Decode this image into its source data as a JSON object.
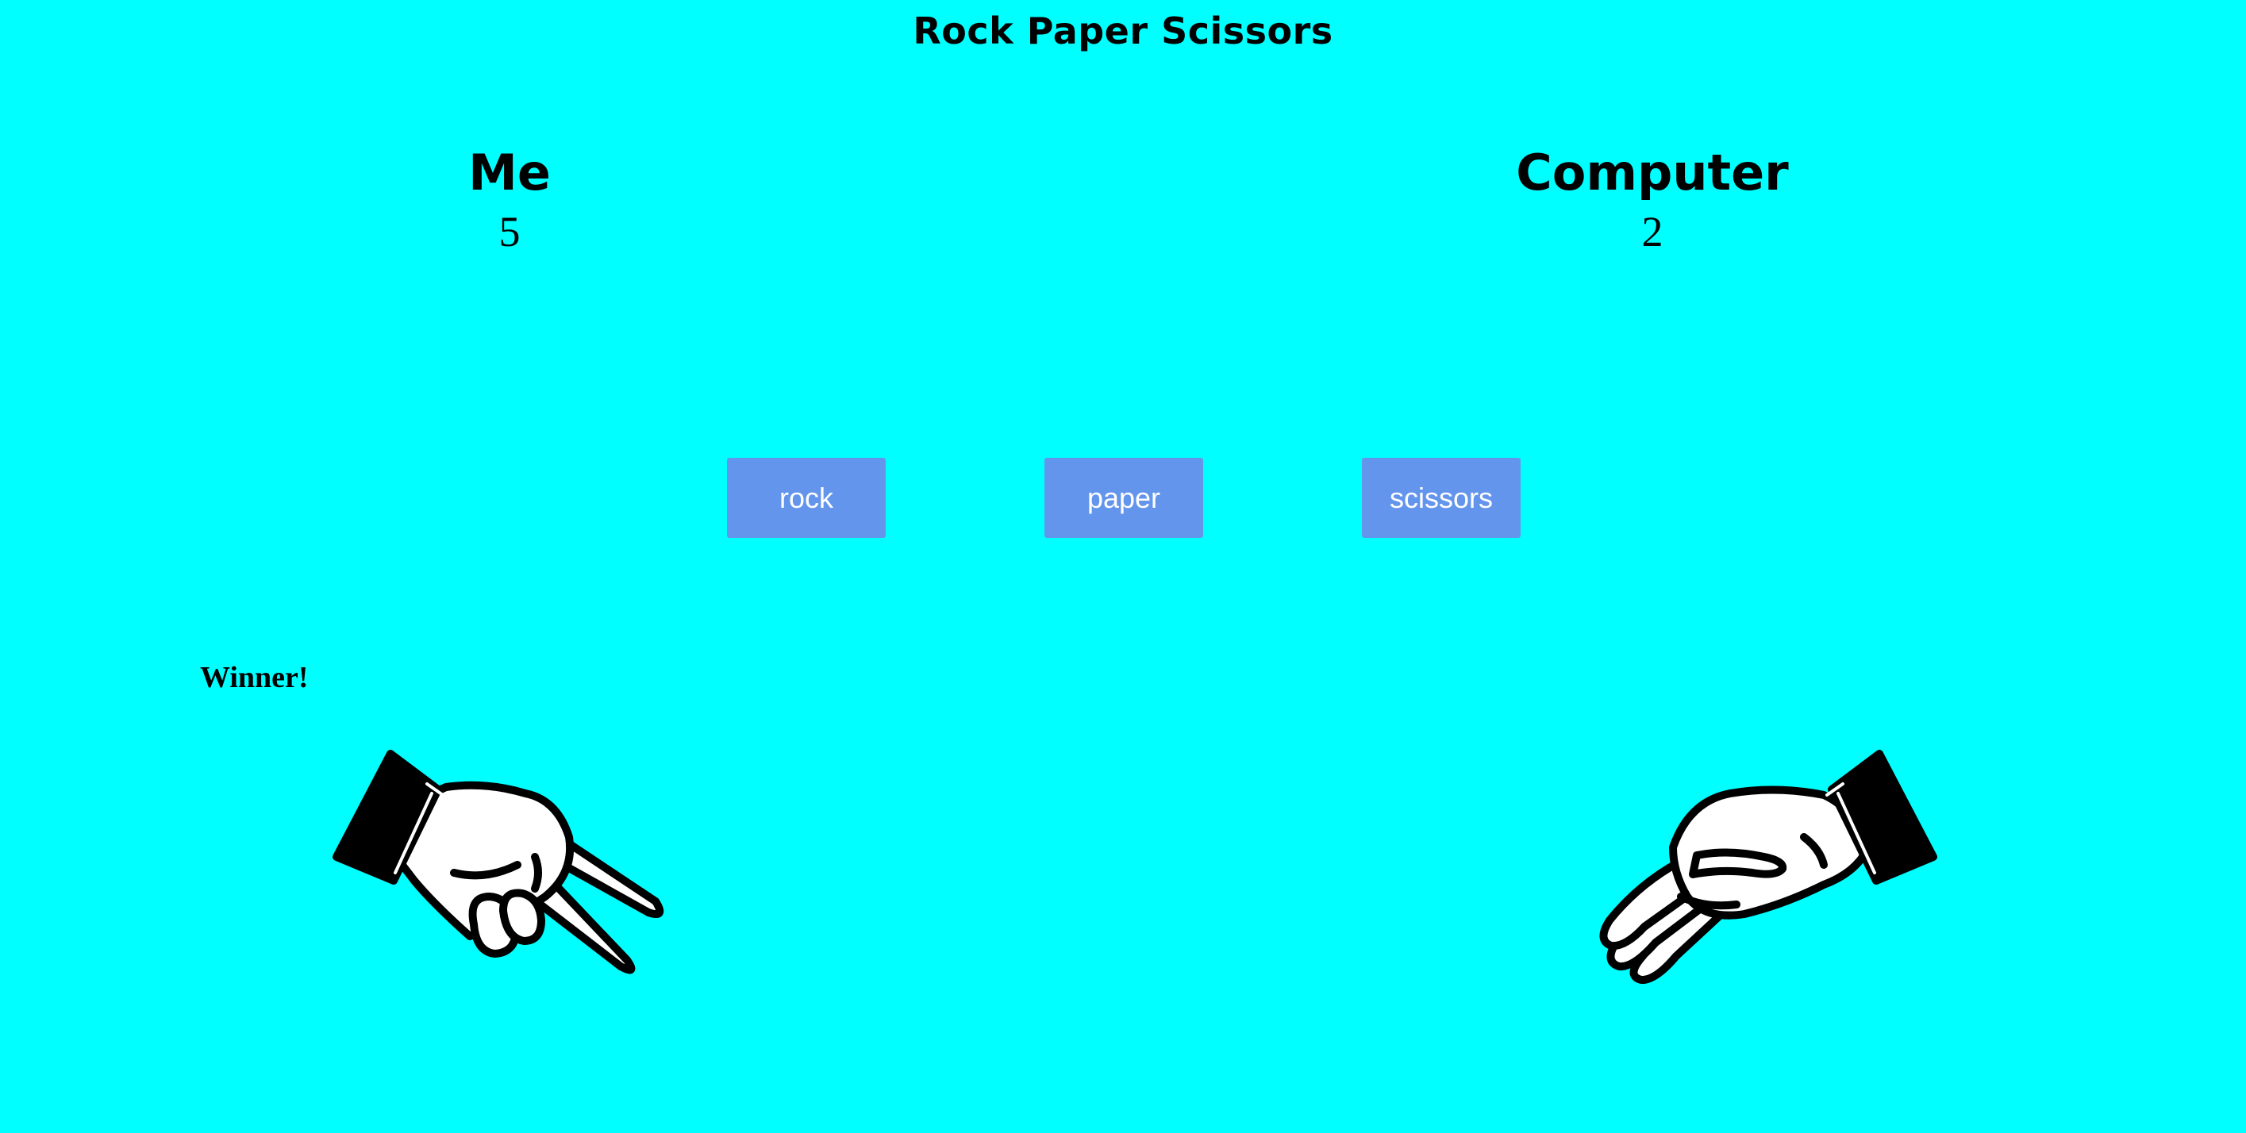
{
  "title": "Rock Paper Scissors",
  "players": {
    "me": {
      "name": "Me",
      "score": "5",
      "choice": "scissors"
    },
    "computer": {
      "name": "Computer",
      "score": "2",
      "choice": "paper"
    }
  },
  "buttons": {
    "rock": "rock",
    "paper": "paper",
    "scissors": "scissors"
  },
  "result": "Winner!",
  "colors": {
    "background": "#00ffff",
    "button": "#6495ed",
    "button_text": "#ffffff"
  },
  "icons": {
    "me_hand": "scissors-hand-icon",
    "computer_hand": "paper-hand-icon"
  }
}
